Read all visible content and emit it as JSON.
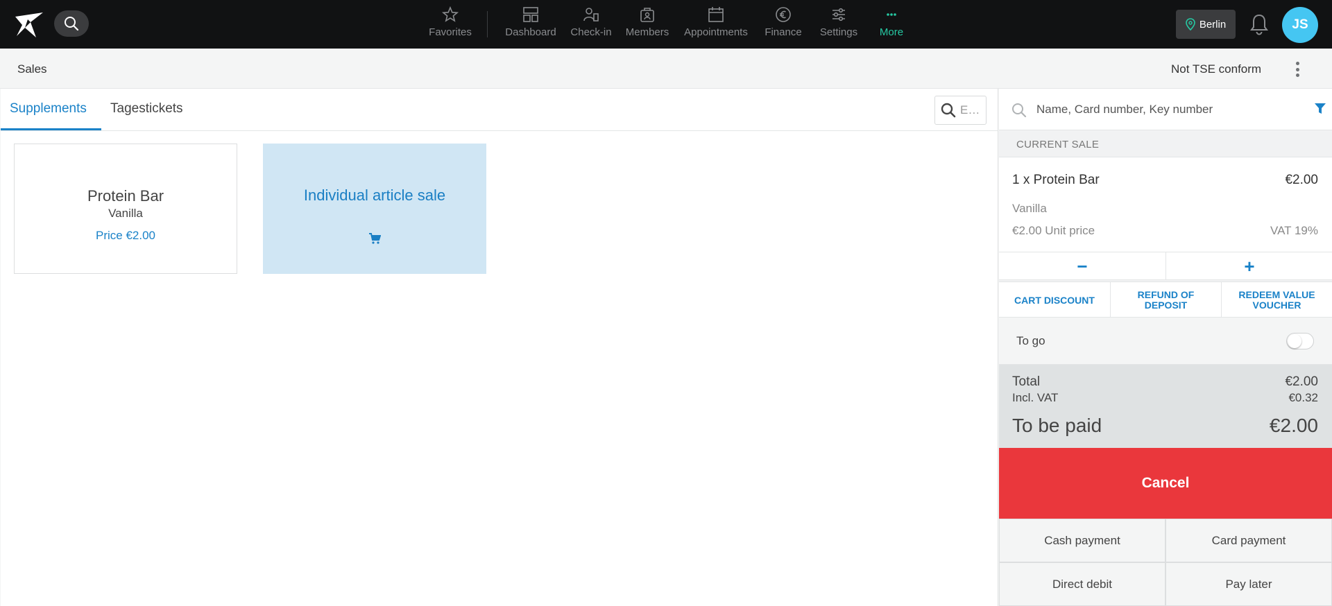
{
  "nav": {
    "items": [
      {
        "label": "Favorites",
        "icon": "star-icon"
      },
      {
        "label": "Dashboard",
        "icon": "dashboard-icon"
      },
      {
        "label": "Check-in",
        "icon": "check-in-icon"
      },
      {
        "label": "Members",
        "icon": "members-icon"
      },
      {
        "label": "Appointments",
        "icon": "calendar-icon"
      },
      {
        "label": "Finance",
        "icon": "euro-icon"
      },
      {
        "label": "Settings",
        "icon": "sliders-icon"
      },
      {
        "label": "More",
        "icon": "more-icon"
      }
    ],
    "location": "Berlin",
    "avatar_initials": "JS",
    "active_color": "#26c9a3"
  },
  "header": {
    "title": "Sales",
    "tse_status": "Not TSE conform"
  },
  "tabs": [
    {
      "label": "Supplements",
      "active": true
    },
    {
      "label": "Tagestickets",
      "active": false
    }
  ],
  "article_search": {
    "placeholder": "E…"
  },
  "products": [
    {
      "name": "Protein Bar",
      "variant": "Vanilla",
      "price": "Price €2.00"
    }
  ],
  "individual_sale": {
    "label": "Individual article sale"
  },
  "customer_search": {
    "placeholder": "Name, Card number, Key number"
  },
  "current_sale": {
    "heading": "CURRENT SALE",
    "item": {
      "name": "1 x Protein Bar",
      "total": "€2.00",
      "variant": "Vanilla",
      "unit_price": "€2.00 Unit price",
      "vat": "VAT 19%"
    },
    "minus": "−",
    "plus": "+"
  },
  "actions": {
    "cart_discount": "CART DISCOUNT",
    "refund_deposit": "REFUND OF DEPOSIT",
    "redeem_voucher": "REDEEM VALUE VOUCHER"
  },
  "to_go": {
    "label": "To go",
    "enabled": false
  },
  "totals": {
    "total_label": "Total",
    "total_value": "€2.00",
    "vat_label": "Incl. VAT",
    "vat_value": "€0.32",
    "pay_label": "To be paid",
    "pay_value": "€2.00"
  },
  "payment": {
    "cancel": "Cancel",
    "cash": "Cash payment",
    "card": "Card payment",
    "direct_debit": "Direct debit",
    "pay_later": "Pay later"
  },
  "colors": {
    "accent": "#1a82c8",
    "cancel": "#ea373c",
    "avatar": "#45c6f2"
  }
}
